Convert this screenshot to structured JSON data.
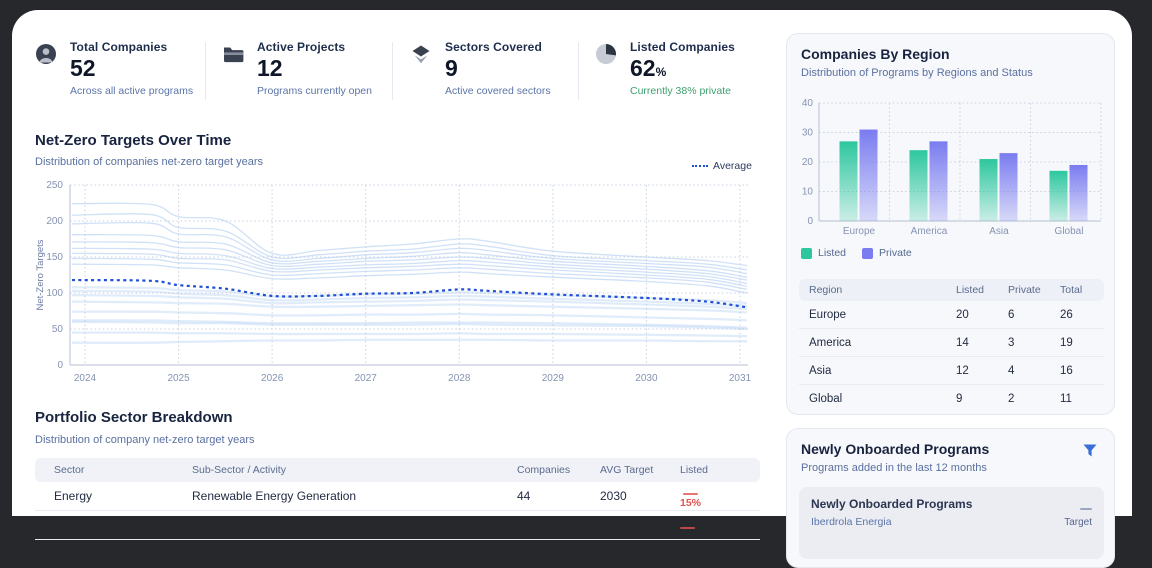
{
  "colors": {
    "accent_blue": "#1e4fd6",
    "light_line": "#a9c9f1",
    "teal": "#2dc79e",
    "purple": "#7a7cf0",
    "red": "#e0524e",
    "green": "#3e9e6f"
  },
  "stats": [
    {
      "label": "Total Companies",
      "value": "52",
      "suffix": "",
      "sub": "Across all active programs",
      "icon": "users-icon"
    },
    {
      "label": "Active Projects",
      "value": "12",
      "suffix": "",
      "sub": "Programs currently open",
      "icon": "folder-icon"
    },
    {
      "label": "Sectors Covered",
      "value": "9",
      "suffix": "",
      "sub": "Active covered sectors",
      "icon": "layers-icon"
    },
    {
      "label": "Listed Companies",
      "value": "62",
      "suffix": "%",
      "sub": "Currently 38% private",
      "icon": "pie-chart-icon",
      "sub_color": "#3e9e6f"
    }
  ],
  "chart_data": [
    {
      "id": "netzero",
      "type": "line",
      "title": "Net-Zero Targets Over Time",
      "subtitle": "Distribution of companies net-zero target years",
      "ylabel": "Net-Zero Targets",
      "legend": "Average",
      "ylim": [
        0,
        250
      ],
      "yticks": [
        0,
        50,
        100,
        150,
        200,
        250
      ],
      "xticks": [
        2024,
        2025,
        2026,
        2027,
        2028,
        2029,
        2030,
        2031
      ],
      "x_points": [
        2024,
        2024.7,
        2025,
        2025.5,
        2026,
        2026.5,
        2027,
        2027.5,
        2028,
        2028.3,
        2029,
        2030,
        2030.65,
        2031
      ],
      "average": [
        118,
        117,
        111,
        106,
        96,
        96,
        99,
        100,
        105,
        103,
        98,
        93,
        88,
        80
      ],
      "company_lines": [
        [
          224,
          223,
          206,
          200,
          155,
          159,
          164,
          168,
          175,
          172,
          158,
          150,
          145,
          138
        ],
        [
          208,
          209,
          191,
          186,
          150,
          153,
          158,
          161,
          168,
          165,
          152,
          145,
          140,
          132
        ],
        [
          196,
          197,
          182,
          178,
          146,
          148,
          153,
          156,
          162,
          159,
          148,
          141,
          136,
          127
        ],
        [
          181,
          180,
          171,
          168,
          142,
          144,
          148,
          151,
          156,
          153,
          144,
          137,
          131,
          122
        ],
        [
          171,
          170,
          163,
          160,
          138,
          140,
          144,
          146,
          150,
          148,
          140,
          133,
          127,
          118
        ],
        [
          162,
          161,
          155,
          152,
          134,
          136,
          139,
          141,
          145,
          143,
          136,
          129,
          123,
          113
        ],
        [
          155,
          154,
          148,
          146,
          130,
          132,
          135,
          137,
          140,
          138,
          132,
          125,
          119,
          109
        ],
        [
          148,
          147,
          142,
          139,
          125,
          127,
          130,
          132,
          135,
          133,
          127,
          121,
          115,
          105
        ],
        [
          140,
          139,
          135,
          132,
          120,
          121,
          124,
          126,
          129,
          127,
          122,
          116,
          110,
          100
        ],
        [
          108,
          107,
          104,
          102,
          95,
          96,
          98,
          99,
          101,
          100,
          97,
          93,
          90,
          86
        ],
        [
          103,
          102,
          99,
          97,
          90,
          91,
          93,
          94,
          96,
          95,
          92,
          88,
          85,
          82
        ],
        [
          97,
          96,
          94,
          92,
          86,
          87,
          88,
          89,
          91,
          90,
          88,
          84,
          81,
          78
        ],
        [
          88,
          87,
          86,
          85,
          81,
          81,
          82,
          83,
          84,
          83,
          81,
          78,
          76,
          73
        ],
        [
          74,
          74,
          73,
          72,
          69,
          69,
          70,
          70,
          71,
          70,
          69,
          66,
          64,
          62
        ],
        [
          62,
          62,
          61,
          60,
          58,
          58,
          58,
          59,
          59,
          59,
          58,
          56,
          54,
          52
        ],
        [
          60,
          59,
          58,
          58,
          56,
          56,
          56,
          56,
          57,
          56,
          55,
          54,
          52,
          50
        ],
        [
          45,
          45,
          44,
          44,
          43,
          43,
          43,
          43,
          44,
          43,
          43,
          42,
          41,
          40
        ],
        [
          31,
          31,
          32,
          33,
          34,
          34,
          35,
          35,
          35,
          35,
          34,
          34,
          33,
          33
        ]
      ]
    },
    {
      "id": "regions",
      "type": "bar",
      "title": "Companies By Region",
      "subtitle": "Distribution of Programs by Regions and Status",
      "categories": [
        "Europe",
        "America",
        "Asia",
        "Global"
      ],
      "series": [
        {
          "name": "Listed",
          "values": [
            27,
            24,
            21,
            17
          ]
        },
        {
          "name": "Private",
          "values": [
            31,
            27,
            23,
            19
          ]
        }
      ],
      "ylim": [
        0,
        40
      ],
      "yticks": [
        0,
        10,
        20,
        30,
        40
      ],
      "legend_position": "bottom"
    }
  ],
  "region_table": {
    "headers": [
      "Region",
      "Listed",
      "Private",
      "Total"
    ],
    "rows": [
      {
        "region": "Europe",
        "listed": "20",
        "private": "6",
        "total": "26"
      },
      {
        "region": "America",
        "listed": "14",
        "private": "3",
        "total": "19"
      },
      {
        "region": "Asia",
        "listed": "12",
        "private": "4",
        "total": "16"
      },
      {
        "region": "Global",
        "listed": "9",
        "private": "2",
        "total": "11"
      }
    ]
  },
  "sector_section": {
    "title": "Portfolio Sector Breakdown",
    "subtitle": "Distribution of company net-zero target years",
    "headers": [
      "Sector",
      "Sub-Sector / Activity",
      "Companies",
      "AVG Target",
      "Listed"
    ],
    "rows": [
      {
        "sector": "Energy",
        "subsector": "Renewable Energy Generation",
        "companies": "44",
        "avg_target": "2030",
        "listed": "15%"
      },
      {
        "sector": "",
        "subsector": "",
        "companies": "",
        "avg_target": "",
        "listed": ""
      }
    ]
  },
  "onboarded": {
    "title": "Newly Onboarded Programs",
    "subtitle": "Programs added in the last 12 months",
    "list_title": "Newly Onboarded Programs",
    "first_item": "Iberdrola Energia",
    "column_label": "Target"
  }
}
